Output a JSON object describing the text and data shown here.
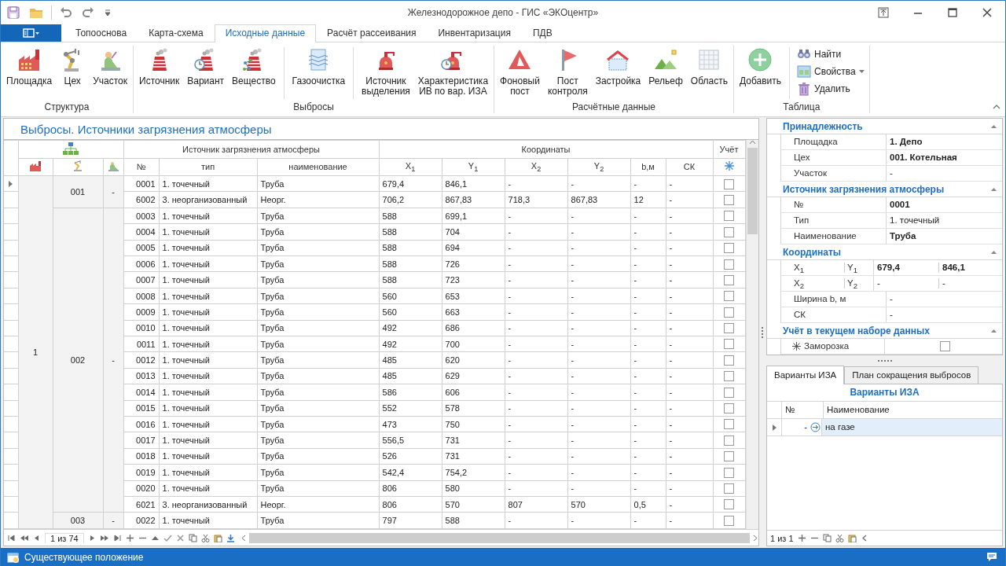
{
  "window": {
    "title": "Железнодорожное депо - ГИС «ЭКОцентр»"
  },
  "ribbon_tabs": [
    {
      "label": "Топооснова",
      "selected": false
    },
    {
      "label": "Карта-схема",
      "selected": false
    },
    {
      "label": "Исходные данные",
      "selected": true
    },
    {
      "label": "Расчёт рассеивания",
      "selected": false
    },
    {
      "label": "Инвентаризация",
      "selected": false
    },
    {
      "label": "ПДВ",
      "selected": false
    }
  ],
  "ribbon_groups": [
    {
      "label": "Структура",
      "sections": [
        {
          "buttons": [
            {
              "label": "Площадка",
              "kind": "large"
            },
            {
              "label": "Цех",
              "kind": "large"
            },
            {
              "label": "Участок",
              "kind": "large"
            }
          ]
        }
      ]
    },
    {
      "label": "Выбросы",
      "sections": [
        {
          "buttons": [
            {
              "label": "Источник",
              "kind": "large"
            },
            {
              "label": "Вариант",
              "kind": "large"
            },
            {
              "label": "Вещество",
              "kind": "large"
            }
          ]
        },
        {
          "buttons": [
            {
              "label": "Газоочистка",
              "kind": "large"
            }
          ]
        },
        {
          "buttons": [
            {
              "label": "Источник\nвыделения",
              "kind": "large"
            },
            {
              "label": "Характеристика\nИВ по вар. ИЗА",
              "kind": "large"
            }
          ]
        }
      ]
    },
    {
      "label": "Расчётные данные",
      "sections": [
        {
          "buttons": [
            {
              "label": "Фоновый\nпост",
              "kind": "large"
            },
            {
              "label": "Пост\nконтроля",
              "kind": "large"
            },
            {
              "label": "Застройка",
              "kind": "large"
            },
            {
              "label": "Рельеф",
              "kind": "large"
            },
            {
              "label": "Область",
              "kind": "large"
            }
          ]
        }
      ]
    },
    {
      "label": "Таблица",
      "sections": [
        {
          "buttons": [
            {
              "label": "Добавить",
              "kind": "large"
            }
          ]
        },
        {
          "buttons": [
            {
              "label": "Найти",
              "kind": "small"
            },
            {
              "label": "Свойства",
              "kind": "dropdown"
            },
            {
              "label": "Удалить",
              "kind": "small"
            }
          ]
        }
      ]
    }
  ],
  "table": {
    "title": "Выбросы. Источники загрязнения атмосферы",
    "header_groups": [
      "Источник загрязнения атмосферы",
      "Координаты",
      "Учёт"
    ],
    "columns": [
      "№",
      "тип",
      "наименование",
      "X$_{1}$",
      "Y$_{1}$",
      "X$_{2}$",
      "Y$_{2}$",
      "b,м",
      "СК"
    ],
    "sites": [
      {
        "label": "1",
        "workshops": [
          {
            "code": "001",
            "section": "-",
            "sources": [
              {
                "values": [
                  "0001",
                  "1. точечный",
                  "Труба",
                  "679,4",
                  "846,1",
                  "-",
                  "-",
                  "-",
                  "-"
                ],
                "selected": true,
                "checked": false
              },
              {
                "values": [
                  "6002",
                  "3. неорганизованный",
                  "Неорг.",
                  "706,2",
                  "867,83",
                  "718,3",
                  "867,83",
                  "12",
                  "-"
                ],
                "selected": false,
                "checked": false
              }
            ]
          },
          {
            "code": "002",
            "section": "-",
            "sources": [
              {
                "values": [
                  "0003",
                  "1. точечный",
                  "Труба",
                  "588",
                  "699,1",
                  "-",
                  "-",
                  "-",
                  "-"
                ],
                "selected": false,
                "checked": false
              },
              {
                "values": [
                  "0004",
                  "1. точечный",
                  "Труба",
                  "588",
                  "704",
                  "-",
                  "-",
                  "-",
                  "-"
                ],
                "selected": false,
                "checked": false
              },
              {
                "values": [
                  "0005",
                  "1. точечный",
                  "Труба",
                  "588",
                  "694",
                  "-",
                  "-",
                  "-",
                  "-"
                ],
                "selected": false,
                "checked": false
              },
              {
                "values": [
                  "0006",
                  "1. точечный",
                  "Труба",
                  "588",
                  "726",
                  "-",
                  "-",
                  "-",
                  "-"
                ],
                "selected": false,
                "checked": false
              },
              {
                "values": [
                  "0007",
                  "1. точечный",
                  "Труба",
                  "588",
                  "723",
                  "-",
                  "-",
                  "-",
                  "-"
                ],
                "selected": false,
                "checked": false
              },
              {
                "values": [
                  "0008",
                  "1. точечный",
                  "Труба",
                  "560",
                  "653",
                  "-",
                  "-",
                  "-",
                  "-"
                ],
                "selected": false,
                "checked": false
              },
              {
                "values": [
                  "0009",
                  "1. точечный",
                  "Труба",
                  "560",
                  "663",
                  "-",
                  "-",
                  "-",
                  "-"
                ],
                "selected": false,
                "checked": false
              },
              {
                "values": [
                  "0010",
                  "1. точечный",
                  "Труба",
                  "492",
                  "686",
                  "-",
                  "-",
                  "-",
                  "-"
                ],
                "selected": false,
                "checked": false
              },
              {
                "values": [
                  "0011",
                  "1. точечный",
                  "Труба",
                  "492",
                  "700",
                  "-",
                  "-",
                  "-",
                  "-"
                ],
                "selected": false,
                "checked": false
              },
              {
                "values": [
                  "0012",
                  "1. точечный",
                  "Труба",
                  "485",
                  "620",
                  "-",
                  "-",
                  "-",
                  "-"
                ],
                "selected": false,
                "checked": false
              },
              {
                "values": [
                  "0013",
                  "1. точечный",
                  "Труба",
                  "485",
                  "629",
                  "-",
                  "-",
                  "-",
                  "-"
                ],
                "selected": false,
                "checked": false
              },
              {
                "values": [
                  "0014",
                  "1. точечный",
                  "Труба",
                  "586",
                  "606",
                  "-",
                  "-",
                  "-",
                  "-"
                ],
                "selected": false,
                "checked": false
              },
              {
                "values": [
                  "0015",
                  "1. точечный",
                  "Труба",
                  "552",
                  "578",
                  "-",
                  "-",
                  "-",
                  "-"
                ],
                "selected": false,
                "checked": false
              },
              {
                "values": [
                  "0016",
                  "1. точечный",
                  "Труба",
                  "473",
                  "750",
                  "-",
                  "-",
                  "-",
                  "-"
                ],
                "selected": false,
                "checked": false
              },
              {
                "values": [
                  "0017",
                  "1. точечный",
                  "Труба",
                  "556,5",
                  "731",
                  "-",
                  "-",
                  "-",
                  "-"
                ],
                "selected": false,
                "checked": false
              },
              {
                "values": [
                  "0018",
                  "1. точечный",
                  "Труба",
                  "526",
                  "731",
                  "-",
                  "-",
                  "-",
                  "-"
                ],
                "selected": false,
                "checked": false
              },
              {
                "values": [
                  "0019",
                  "1. точечный",
                  "Труба",
                  "542,4",
                  "754,2",
                  "-",
                  "-",
                  "-",
                  "-"
                ],
                "selected": false,
                "checked": false
              },
              {
                "values": [
                  "0020",
                  "1. точечный",
                  "Труба",
                  "806",
                  "580",
                  "-",
                  "-",
                  "-",
                  "-"
                ],
                "selected": false,
                "checked": false
              },
              {
                "values": [
                  "6021",
                  "3. неорганизованный",
                  "Неорг.",
                  "806",
                  "570",
                  "807",
                  "570",
                  "0,5",
                  "-"
                ],
                "selected": false,
                "checked": false
              }
            ]
          },
          {
            "code": "003",
            "section": "-",
            "sources": [
              {
                "values": [
                  "0022",
                  "1. точечный",
                  "Труба",
                  "797",
                  "588",
                  "-",
                  "-",
                  "-",
                  "-"
                ],
                "selected": false,
                "checked": false
              }
            ]
          }
        ]
      }
    ],
    "navigator": "1 из 74"
  },
  "properties": [
    {
      "title": "Принадлежность",
      "rows": [
        {
          "kind": "text",
          "label": "Площадка",
          "value": "1. Депо",
          "bold": true
        },
        {
          "kind": "text",
          "label": "Цех",
          "value": "001. Котельная",
          "bold": true
        },
        {
          "kind": "text",
          "label": "Участок",
          "value": "-",
          "bold": false
        }
      ]
    },
    {
      "title": "Источник загрязнения атмосферы",
      "rows": [
        {
          "kind": "text",
          "label": "№",
          "value": "0001",
          "bold": true
        },
        {
          "kind": "text",
          "label": "Тип",
          "value": "1. точечный",
          "bold": false
        },
        {
          "kind": "text",
          "label": "Наименование",
          "value": "Труба",
          "bold": true
        }
      ]
    },
    {
      "title": "Координаты",
      "rows": [
        {
          "kind": "pair",
          "labels": [
            "X$_{1}$",
            "Y$_{1}$"
          ],
          "values": [
            "679,4",
            "846,1"
          ],
          "bold": true
        },
        {
          "kind": "pair",
          "labels": [
            "X$_{2}$",
            "Y$_{2}$"
          ],
          "values": [
            "-",
            "-"
          ],
          "bold": false
        },
        {
          "kind": "text",
          "label": "Ширина b, м",
          "value": "-",
          "bold": false
        },
        {
          "kind": "text",
          "label": "СК",
          "value": "-",
          "bold": false
        }
      ]
    },
    {
      "title": "Учёт в текущем наборе данных",
      "rows": [
        {
          "kind": "check",
          "label": "Заморозка",
          "checked": false
        }
      ]
    }
  ],
  "detail_tabs": [
    {
      "label": "Варианты ИЗА",
      "selected": true
    },
    {
      "label": "План сокращения выбросов",
      "selected": false
    }
  ],
  "variants": {
    "title": "Варианты ИЗА",
    "columns": [
      "№",
      "Наименование"
    ],
    "rows": [
      {
        "number": "-",
        "name": "на газе",
        "selected": true
      }
    ],
    "navigator": "1 из 1"
  },
  "status_bar": {
    "text": "Существующее положение"
  }
}
